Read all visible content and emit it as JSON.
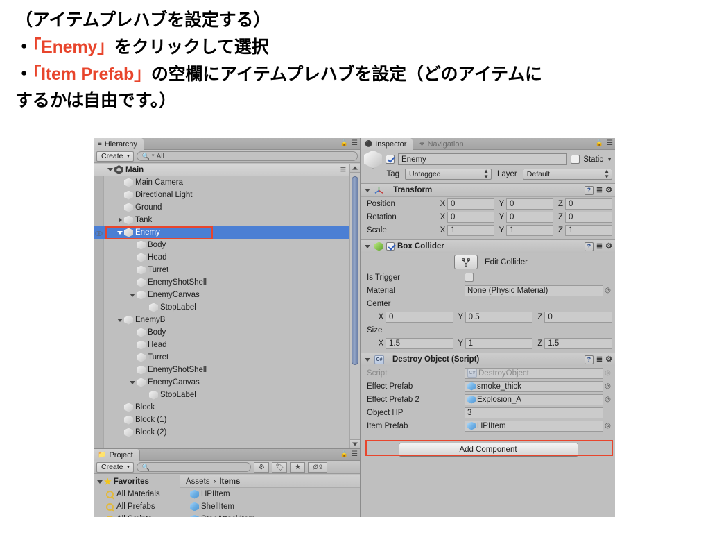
{
  "slide": {
    "lines": [
      {
        "text": "（アイテムプレハブを設定する）",
        "highlight": null
      },
      {
        "pre": "・",
        "highlight": "「Enemy」",
        "post": "をクリックして選択"
      },
      {
        "pre": "・",
        "highlight": "「Item Prefab」",
        "post": "の空欄にアイテムプレハブを設定（どのアイテムに"
      },
      {
        "text": "するかは自由です。）",
        "highlight": null
      }
    ],
    "line1": "（アイテムプレハブを設定する）",
    "line2_pre": "・",
    "line2_hl": "「Enemy」",
    "line2_post": "をクリックして選択",
    "line3_pre": "・",
    "line3_hl": "「Item Prefab」",
    "line3_post": "の空欄にアイテムプレハブを設定（どのアイテムに",
    "line4": "するかは自由です。）",
    "highlight_color": "#e8452c"
  },
  "hierarchy": {
    "tab_label": "Hierarchy",
    "tab_icon": "hierarchy-icon",
    "create_label": "Create",
    "search_value": "",
    "search_placeholder": "All",
    "search_icon": "search-icon",
    "lock_icon": "lock-icon",
    "menu_icon": "panel-menu-icon",
    "root": {
      "label": "Main",
      "icon": "unity-scene-icon",
      "expanded": true
    },
    "items": [
      {
        "label": "Main Camera",
        "depth": 2,
        "arrow": "none",
        "selected": false
      },
      {
        "label": "Directional Light",
        "depth": 2,
        "arrow": "none",
        "selected": false
      },
      {
        "label": "Ground",
        "depth": 2,
        "arrow": "none",
        "selected": false
      },
      {
        "label": "Tank",
        "depth": 2,
        "arrow": "collapsed",
        "selected": false
      },
      {
        "label": "Enemy",
        "depth": 2,
        "arrow": "expanded",
        "selected": true
      },
      {
        "label": "Body",
        "depth": 3,
        "arrow": "none",
        "selected": false
      },
      {
        "label": "Head",
        "depth": 3,
        "arrow": "none",
        "selected": false
      },
      {
        "label": "Turret",
        "depth": 3,
        "arrow": "none",
        "selected": false
      },
      {
        "label": "EnemyShotShell",
        "depth": 3,
        "arrow": "none",
        "selected": false
      },
      {
        "label": "EnemyCanvas",
        "depth": 3,
        "arrow": "expanded",
        "selected": false
      },
      {
        "label": "StopLabel",
        "depth": 4,
        "arrow": "none",
        "selected": false
      },
      {
        "label": "EnemyB",
        "depth": 2,
        "arrow": "expanded",
        "selected": false
      },
      {
        "label": "Body",
        "depth": 3,
        "arrow": "none",
        "selected": false
      },
      {
        "label": "Head",
        "depth": 3,
        "arrow": "none",
        "selected": false
      },
      {
        "label": "Turret",
        "depth": 3,
        "arrow": "none",
        "selected": false
      },
      {
        "label": "EnemyShotShell",
        "depth": 3,
        "arrow": "none",
        "selected": false
      },
      {
        "label": "EnemyCanvas",
        "depth": 3,
        "arrow": "expanded",
        "selected": false
      },
      {
        "label": "StopLabel",
        "depth": 4,
        "arrow": "none",
        "selected": false
      },
      {
        "label": "Block",
        "depth": 2,
        "arrow": "none",
        "selected": false
      },
      {
        "label": "Block (1)",
        "depth": 2,
        "arrow": "none",
        "selected": false
      },
      {
        "label": "Block (2)",
        "depth": 2,
        "arrow": "none",
        "selected": false
      }
    ],
    "selection_color": "#4b7fd4"
  },
  "project": {
    "tab_label": "Project",
    "tab_icon": "folder-icon",
    "create_label": "Create",
    "search_value": "",
    "search_icon": "search-icon",
    "lock_icon": "lock-icon",
    "menu_icon": "panel-menu-icon",
    "filter_buttons": [
      {
        "name": "filter-by-type-icon",
        "glyph": "♣"
      },
      {
        "name": "filter-by-label-icon",
        "glyph": "⚑"
      },
      {
        "name": "favorite-star-icon",
        "glyph": "★"
      }
    ],
    "hidden_count": "9",
    "hidden_icon": "eye-off-icon",
    "favorites": {
      "label": "Favorites",
      "icon": "star-icon",
      "items": [
        {
          "label": "All Materials",
          "icon": "search-icon"
        },
        {
          "label": "All Prefabs",
          "icon": "search-icon"
        },
        {
          "label": "All Scripts",
          "icon": "search-icon"
        }
      ]
    },
    "breadcrumb": {
      "root": "Assets",
      "separator": "›",
      "current": "Items"
    },
    "assets": [
      {
        "label": "HPIItem",
        "icon": "prefab-cube-icon"
      },
      {
        "label": "ShellItem",
        "icon": "prefab-cube-icon"
      },
      {
        "label": "StopAttackItem",
        "icon": "prefab-cube-icon"
      }
    ]
  },
  "inspector": {
    "tabs": [
      {
        "label": "Inspector",
        "icon": "inspector-icon",
        "active": true
      },
      {
        "label": "Navigation",
        "icon": "navigation-icon",
        "active": false
      }
    ],
    "lock_icon": "lock-icon",
    "menu_icon": "panel-menu-icon",
    "object": {
      "enabled": true,
      "name": "Enemy",
      "static_label": "Static",
      "static_checked": false,
      "tag_label": "Tag",
      "tag_value": "Untagged",
      "layer_label": "Layer",
      "layer_value": "Default"
    },
    "transform": {
      "title": "Transform",
      "icon": "transform-axis-icon",
      "expanded": true,
      "rows": [
        {
          "label": "Position",
          "x": "0",
          "y": "0",
          "z": "0"
        },
        {
          "label": "Rotation",
          "x": "0",
          "y": "0",
          "z": "0"
        },
        {
          "label": "Scale",
          "x": "1",
          "y": "1",
          "z": "1"
        }
      ],
      "axes": [
        "X",
        "Y",
        "Z"
      ]
    },
    "box_collider": {
      "title": "Box Collider",
      "icon": "box-collider-icon",
      "enabled": true,
      "expanded": true,
      "edit_collider_label": "Edit Collider",
      "edit_collider_icon": "edit-collider-icon",
      "is_trigger_label": "Is Trigger",
      "is_trigger_checked": false,
      "material_label": "Material",
      "material_value": "None (Physic Material)",
      "center_label": "Center",
      "center": {
        "x": "0",
        "y": "0.5",
        "z": "0"
      },
      "size_label": "Size",
      "size": {
        "x": "1.5",
        "y": "1",
        "z": "1.5"
      }
    },
    "destroy_object": {
      "title": "Destroy Object (Script)",
      "icon": "csharp-script-icon",
      "expanded": true,
      "fields": [
        {
          "label": "Script",
          "value": "DestroyObject",
          "kind": "script",
          "disabled": true
        },
        {
          "label": "Effect Prefab",
          "value": "smoke_thick",
          "kind": "object",
          "disabled": false
        },
        {
          "label": "Effect Prefab 2",
          "value": "Explosion_A",
          "kind": "object",
          "disabled": false
        },
        {
          "label": "Object HP",
          "value": "3",
          "kind": "number",
          "disabled": false
        },
        {
          "label": "Item Prefab",
          "value": "HPIItem",
          "kind": "object",
          "disabled": false,
          "highlighted": true
        }
      ]
    },
    "add_component_label": "Add Component"
  },
  "annotations": {
    "box_color": "#e8452c",
    "boxes": [
      {
        "name": "enemy-hierarchy-highlight"
      },
      {
        "name": "item-prefab-highlight"
      }
    ]
  }
}
